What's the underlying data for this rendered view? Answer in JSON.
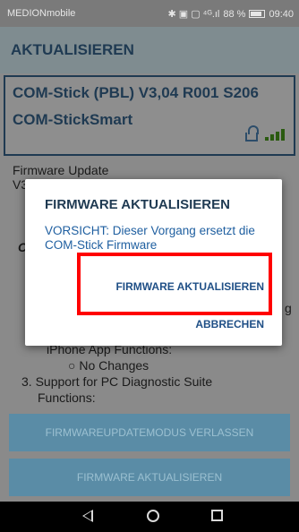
{
  "status_bar": {
    "carrier": "MEDIONmobile",
    "icons_text": "✱ ▣ ▢ ⁴ᴳ.ıl",
    "battery_percent": "88 %",
    "time": "09:40",
    "battery_level": 0.88
  },
  "app_bar": {
    "title": "AKTUALISIEREN"
  },
  "device": {
    "name": "COM-Stick (PBL) V3,04 R001 S206",
    "type": "COM-StickSmart",
    "lock_icon": "unlocked-lock-icon",
    "signal_icon": "signal-strength-icon"
  },
  "background_text": {
    "fw_label": "Firmware Update",
    "fw_version_prefix": "V3",
    "c_fragment": "C",
    "right_fragment": "g",
    "iphone": "iPhone App Functions:",
    "no_changes": "○ No Changes",
    "item3": "3. Support for PC Diagnostic Suite",
    "functions": "Functions:"
  },
  "dialog": {
    "title": "FIRMWARE AKTUALISIEREN",
    "message": "VORSICHT: Dieser Vorgang ersetzt die COM-Stick Firmware",
    "confirm_label": "FIRMWARE AKTUALISIEREN",
    "cancel_label": "ABBRECHEN"
  },
  "buttons": {
    "exit_update_mode": "FIRMWAREUPDATEMODUS VERLASSEN",
    "update_firmware": "FIRMWARE AKTUALISIEREN"
  },
  "nav": {
    "back": "back-icon",
    "home": "home-icon",
    "recent": "recent-apps-icon"
  }
}
